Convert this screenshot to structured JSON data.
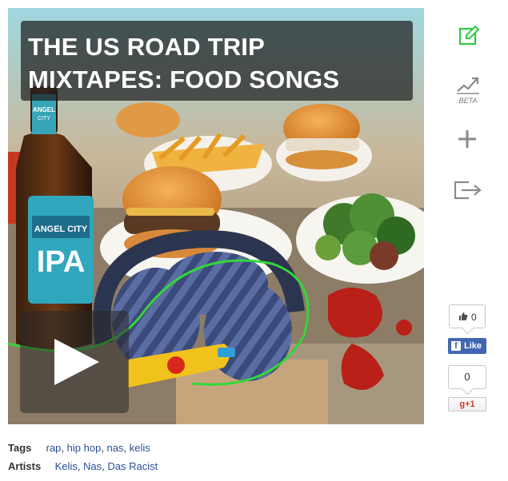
{
  "cover": {
    "title_lines": [
      "THE US ROAD TRIP",
      "MIXTAPES: FOOD SONGS"
    ],
    "play_icon": "play-icon"
  },
  "sidebar": {
    "edit_icon": "edit-icon",
    "stats_icon": "trending-chart-icon",
    "beta_label": "BETA",
    "add_icon": "plus-icon",
    "share_icon": "export-icon",
    "accent_color": "#2ecc40"
  },
  "social": {
    "facebook_count": "0",
    "facebook_like_label": "Like",
    "facebook_letter": "f",
    "gplus_count": "0",
    "gplus_label": "g+1"
  },
  "meta": {
    "tags_label": "Tags",
    "tags": [
      "rap",
      "hip hop",
      "nas",
      "kelis"
    ],
    "artists_label": "Artists",
    "artists": [
      "Kelis",
      "Nas",
      "Das Racist"
    ]
  }
}
